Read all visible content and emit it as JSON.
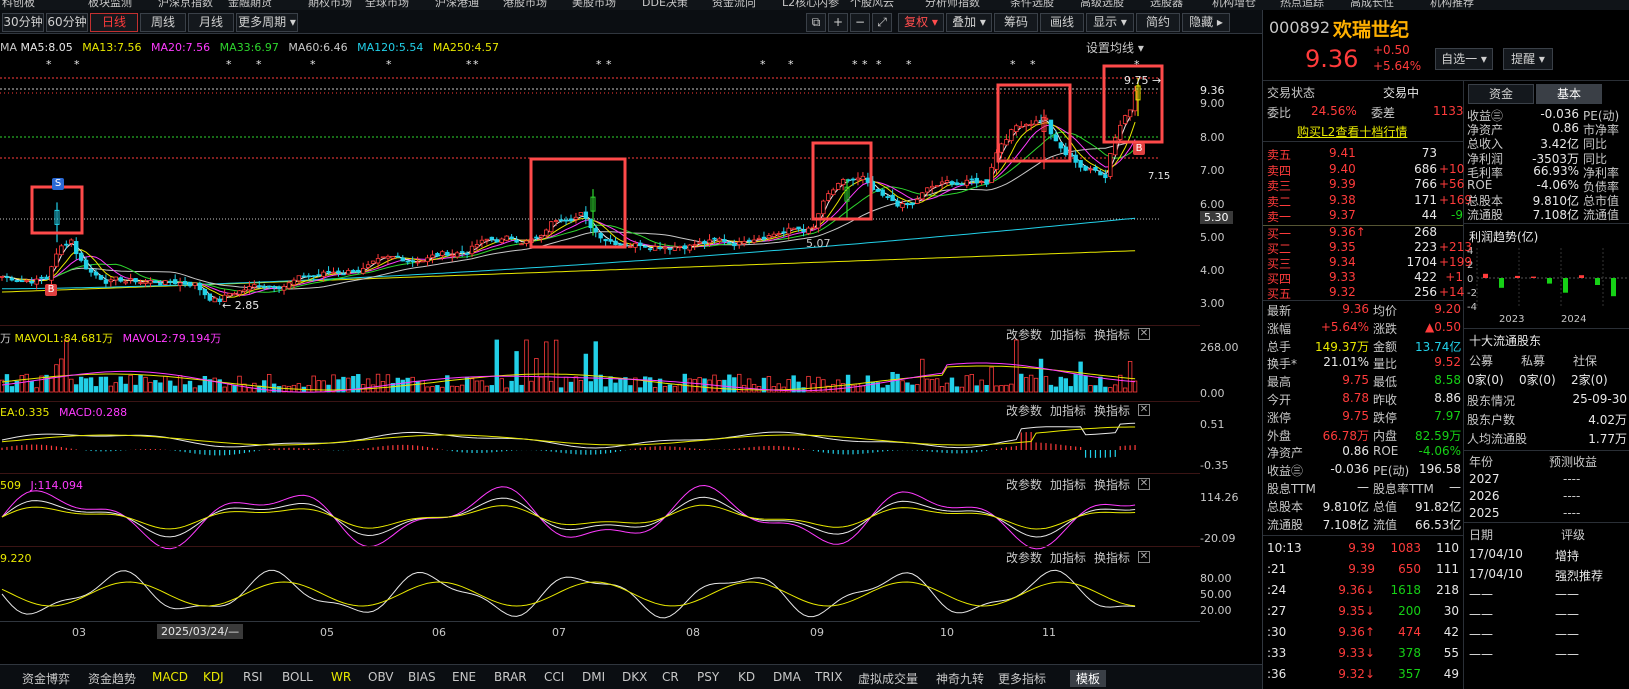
{
  "topmenu": [
    "科创板",
    "板块监测",
    "沪深京指数",
    "金融期货",
    "期权市场",
    "全球市场",
    "沪深港通",
    "港股市场",
    "美股市场",
    "DDE决策",
    "资金流向",
    "L2核心内参",
    "个股风云",
    "分析师指数",
    "条件选股",
    "高级选股",
    "选股器",
    "机构增仓",
    "热点追踪",
    "高成长性",
    "机构推荐"
  ],
  "toolbar": {
    "periods": [
      "30分钟",
      "60分钟",
      "日线",
      "周线",
      "月线",
      "更多周期 ▾"
    ],
    "icons": [
      "⧉",
      "+",
      "−",
      "⤢"
    ],
    "buttons": [
      "复权 ▾",
      "叠加 ▾",
      "筹码",
      "画线",
      "显示 ▾",
      "简约",
      "隐藏 ▸"
    ]
  },
  "ma_legend": {
    "ma5": "MA5:8.05",
    "ma13": "MA13:7.56",
    "ma20": "MA20:7.56",
    "ma33": "MA33:6.97",
    "ma60": "MA60:6.46",
    "ma120": "MA120:5.54",
    "ma250": "MA250:4.57",
    "settings": "设置均线 ▾",
    "colors": {
      "ma5": "#e8e8e8",
      "ma13": "#e8e800",
      "ma20": "#ff3bff",
      "ma33": "#2ed62e",
      "ma60": "#c8c8c8",
      "ma120": "#22d0e8",
      "ma250": "#e8e800"
    }
  },
  "main_axis": [
    "9.36",
    "9.00",
    "8.00",
    "7.00",
    "6.00",
    "5.30",
    "5.00",
    "4.00",
    "3.00"
  ],
  "main_notes": {
    "high": "9.75",
    "low": "2.85",
    "mid": "5.07",
    "last": "7.15",
    "mark_s": "S",
    "mark_b": "B"
  },
  "vol_legend": {
    "vol1": "MAVOL1:84.681万",
    "vol2": "MAVOL2:79.194万"
  },
  "vol_axis": [
    "268.00",
    "0.00"
  ],
  "macd_legend": {
    "dea": "EA:0.335",
    "macd": "MACD:0.288"
  },
  "macd_axis": [
    "0.51",
    "-0.35"
  ],
  "kdj_legend": {
    "j": "J:114.094",
    "k": "509"
  },
  "kdj_axis": [
    "114.26",
    "-20.09"
  ],
  "wr_legend": {
    "v": "9.220"
  },
  "wr_axis": [
    "80.00",
    "50.00",
    "20.00"
  ],
  "panel_tools": {
    "params": "改参数",
    "add": "加指标",
    "swap": "换指标",
    "close": "✕"
  },
  "xaxis": {
    "labels": [
      "03",
      "05",
      "06",
      "07",
      "08",
      "09",
      "10",
      "11"
    ],
    "cursor": "2025/03/24/—"
  },
  "bottom_tabs": [
    "资金博弈",
    "资金趋势",
    "MACD",
    "KDJ",
    "RSI",
    "BOLL",
    "WR",
    "OBV",
    "BIAS",
    "ENE",
    "BRAR",
    "CCI",
    "DMI",
    "DKX",
    "CR",
    "PSY",
    "KD",
    "DMA",
    "TRIX",
    "虚拟成交量",
    "神奇九转",
    "更多指标",
    "模板"
  ],
  "stock": {
    "code": "000892",
    "name": "欢瑞世纪",
    "price": "9.36",
    "chg": "+0.50",
    "pct": "+5.64%",
    "watch": "自选一 ▾",
    "alert": "提醒 ▾"
  },
  "status": {
    "label": "交易状态",
    "value": "交易中"
  },
  "order_ratio": {
    "wb_label": "委比",
    "wb": "24.56%",
    "wc_label": "委差",
    "wc": "1133"
  },
  "l2_link": "购买L2查看十档行情",
  "asks": [
    [
      "卖五",
      "9.41",
      "73",
      ""
    ],
    [
      "卖四",
      "9.40",
      "686",
      "+10"
    ],
    [
      "卖三",
      "9.39",
      "766",
      "+56"
    ],
    [
      "卖二",
      "9.38",
      "171",
      "+169"
    ],
    [
      "卖一",
      "9.37",
      "44",
      "-9"
    ]
  ],
  "bids": [
    [
      "买一",
      "9.36↑",
      "268",
      ""
    ],
    [
      "买二",
      "9.35",
      "223",
      "+213"
    ],
    [
      "买三",
      "9.34",
      "1704",
      "+199"
    ],
    [
      "买四",
      "9.33",
      "422",
      "+1"
    ],
    [
      "买五",
      "9.32",
      "256",
      "+14"
    ]
  ],
  "quote": [
    [
      "最新",
      "9.36",
      "均价",
      "9.20"
    ],
    [
      "涨幅",
      "+5.64%",
      "涨跌",
      "▲0.50"
    ],
    [
      "总手",
      "149.37万",
      "金额",
      "13.74亿"
    ],
    [
      "换手*",
      "21.01%",
      "量比",
      "9.52"
    ],
    [
      "最高",
      "9.75",
      "最低",
      "8.58"
    ],
    [
      "今开",
      "8.78",
      "昨收",
      "8.86"
    ],
    [
      "涨停",
      "9.75",
      "跌停",
      "7.97"
    ],
    [
      "外盘",
      "66.78万",
      "内盘",
      "82.59万"
    ],
    [
      "净资产",
      "0.86",
      "ROE",
      "-4.06%"
    ],
    [
      "收益㊂",
      "-0.036",
      "PE(动)",
      "196.58"
    ],
    [
      "股息TTM",
      "—",
      "股息率TTM",
      "—"
    ],
    [
      "总股本",
      "9.810亿",
      "总值",
      "91.82亿"
    ],
    [
      "流通股",
      "7.108亿",
      "流值",
      "66.53亿"
    ]
  ],
  "ticks": [
    [
      "10:13",
      "9.39",
      "1083",
      "110"
    ],
    [
      ":21",
      "9.39",
      "650",
      "111"
    ],
    [
      ":24",
      "9.36↓",
      "1618",
      "218"
    ],
    [
      ":27",
      "9.35↓",
      "200",
      "30"
    ],
    [
      ":30",
      "9.36↑",
      "474",
      "42"
    ],
    [
      ":33",
      "9.33↓",
      "378",
      "55"
    ],
    [
      ":36",
      "9.32↓",
      "357",
      "49"
    ]
  ],
  "fin_tabs": [
    "资金",
    "基本"
  ],
  "fin": [
    [
      "收益㊂",
      "-0.036",
      "PE(动)"
    ],
    [
      "净资产",
      "0.86",
      "市净率"
    ],
    [
      "总收入",
      "3.42亿",
      "同比"
    ],
    [
      "净利润",
      "-3503万",
      "同比"
    ],
    [
      "毛利率",
      "66.93%",
      "净利率"
    ],
    [
      "ROE",
      "-4.06%",
      "负债率"
    ],
    [
      "总股本",
      "9.810亿",
      "总市值"
    ],
    [
      "流通股",
      "7.108亿",
      "流通值"
    ]
  ],
  "profit": {
    "title": "利润趋势(亿)",
    "y": [
      "4",
      "2",
      "0",
      "-2",
      "-4"
    ],
    "years": [
      "2023",
      "2024"
    ],
    "bars": [
      0.6,
      -1.4,
      0.3,
      0.2,
      -0.8,
      -2.1,
      0.4,
      -1.0,
      -2.6
    ]
  },
  "holders": {
    "title": "十大流通股东",
    "cols": [
      "公募",
      "私募",
      "社保"
    ],
    "vals": [
      "0家(0)",
      "0家(0)",
      "2家(0)"
    ],
    "rows": [
      [
        "股东情况",
        "25-09-30"
      ],
      [
        "股东户数",
        "4.02万"
      ],
      [
        "人均流通股",
        "1.77万"
      ]
    ]
  },
  "forecast": {
    "col1": "年份",
    "col2": "预测收益",
    "rows": [
      [
        "2027",
        "----"
      ],
      [
        "2026",
        "----"
      ],
      [
        "2025",
        "----"
      ]
    ]
  },
  "ratings": {
    "col1": "日期",
    "col2": "评级",
    "rows": [
      [
        "17/04/10",
        "增持"
      ],
      [
        "17/04/10",
        "强烈推荐"
      ],
      [
        "——",
        "——"
      ],
      [
        "——",
        "——"
      ],
      [
        "——",
        "——"
      ],
      [
        "——",
        "——"
      ]
    ]
  }
}
